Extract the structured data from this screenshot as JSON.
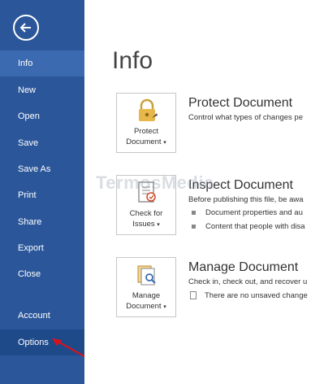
{
  "sidebar": {
    "items": [
      {
        "label": "Info",
        "name": "nav-info"
      },
      {
        "label": "New",
        "name": "nav-new"
      },
      {
        "label": "Open",
        "name": "nav-open"
      },
      {
        "label": "Save",
        "name": "nav-save"
      },
      {
        "label": "Save As",
        "name": "nav-save-as"
      },
      {
        "label": "Print",
        "name": "nav-print"
      },
      {
        "label": "Share",
        "name": "nav-share"
      },
      {
        "label": "Export",
        "name": "nav-export"
      },
      {
        "label": "Close",
        "name": "nav-close"
      },
      {
        "label": "Account",
        "name": "nav-account"
      },
      {
        "label": "Options",
        "name": "nav-options"
      }
    ],
    "active": "Info",
    "back_icon": "back-arrow-icon"
  },
  "main": {
    "title": "Info",
    "sections": [
      {
        "button_label_1": "Protect",
        "button_label_2": "Document",
        "icon": "lock-icon",
        "title": "Protect Document",
        "desc": "Control what types of changes pe"
      },
      {
        "button_label_1": "Check for",
        "button_label_2": "Issues",
        "icon": "checklist-icon",
        "title": "Inspect Document",
        "desc": "Before publishing this file, be awa",
        "bullets": [
          "Document properties and au",
          "Content that people with disa"
        ]
      },
      {
        "button_label_1": "Manage",
        "button_label_2": "Document",
        "icon": "manage-document-icon",
        "title": "Manage Document",
        "desc": "Check in, check out, and recover u",
        "note": "There are no unsaved change"
      }
    ]
  },
  "watermark": "TermosMedia",
  "colors": {
    "sidebar": "#2b579a",
    "sidebar_active": "#3c6ab0",
    "arrow": "#e0101a"
  }
}
